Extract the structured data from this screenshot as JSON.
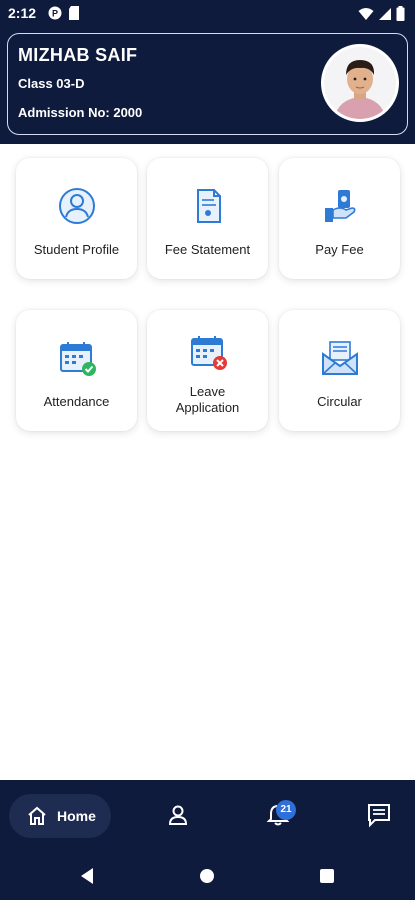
{
  "status_bar": {
    "time": "2:12"
  },
  "student": {
    "name": "MIZHAB SAIF",
    "class": "Class 03-D",
    "admission": "Admission No: 2000"
  },
  "tiles": [
    {
      "label": "Student Profile",
      "icon": "user-circle-icon"
    },
    {
      "label": "Fee Statement",
      "icon": "document-icon"
    },
    {
      "label": "Pay Fee",
      "icon": "hand-money-icon"
    },
    {
      "label": "Attendance",
      "icon": "calendar-check-icon"
    },
    {
      "label": "Leave\nApplication",
      "icon": "calendar-cross-icon"
    },
    {
      "label": "Circular",
      "icon": "mail-letter-icon"
    }
  ],
  "bottom_nav": {
    "home_label": "Home",
    "notification_count": "21"
  },
  "colors": {
    "header_bg": "#0f1b3d",
    "icon_blue": "#2e7bd6",
    "badge_blue": "#2f6fd9"
  }
}
